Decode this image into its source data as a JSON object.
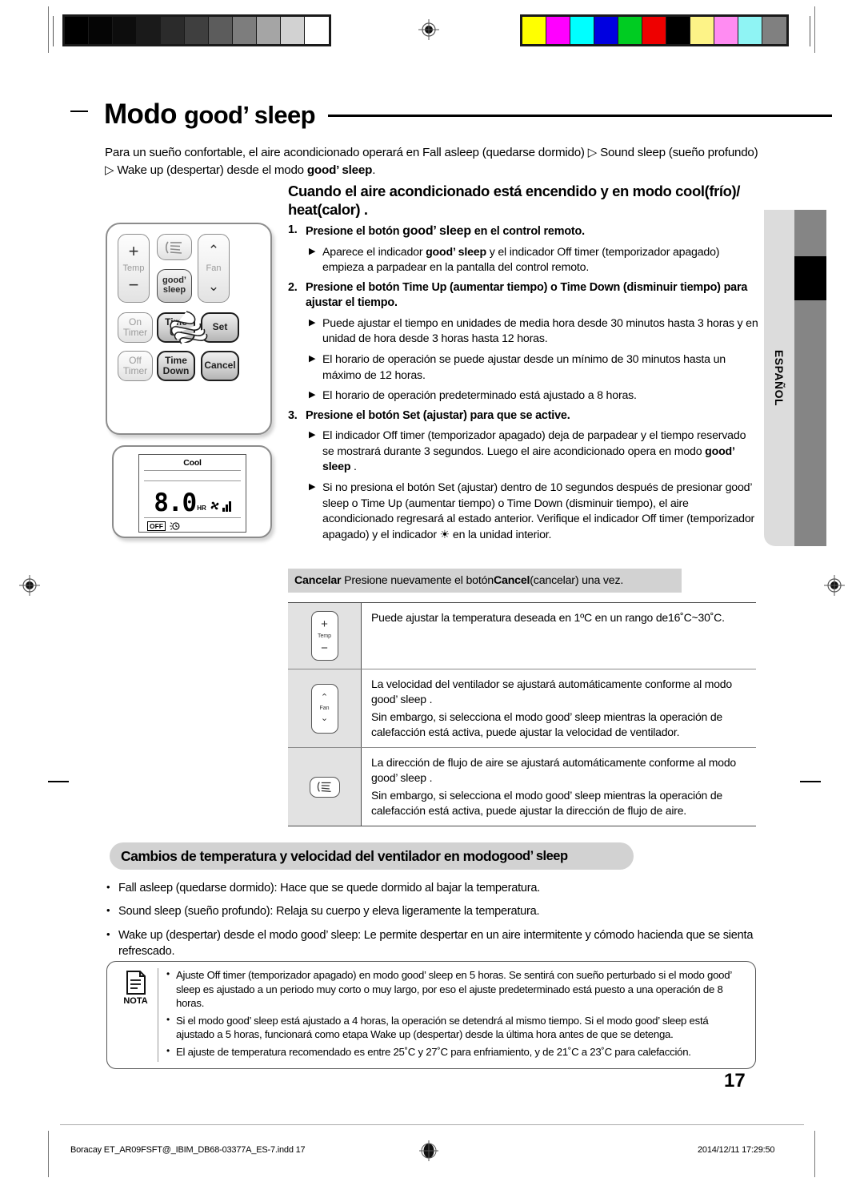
{
  "doc": {
    "title": "Modo good' sleep",
    "title_main": "Modo ",
    "title_brand": "good’ sleep",
    "page_number": "17",
    "side_tab_label": "ESPAÑOL"
  },
  "intro": {
    "line1": "Para un sueño confortable, el aire acondicionado operará en Fall asleep (quedarse dormido) ▷ Sound sleep (sueño profundo)",
    "line2_pre": "▷ Wake up (despertar) desde el modo ",
    "line2_brand": "good’ sleep",
    "line2_post": "."
  },
  "section1": {
    "heading_line1": "Cuando el aire acondicionado está encendido y en modo cool(frío)/",
    "heading_line2": "heat(calor) .",
    "steps": [
      {
        "num": "1.",
        "text_pre": "Presione el botón ",
        "brand": "good’ sleep",
        "text_post": " en el control remoto.",
        "subs": [
          {
            "pre": "Aparece el indicador ",
            "brand": "good’ sleep",
            "post": " y el indicador Off timer (temporizador apagado) empieza a parpadear en la pantalla del control remoto."
          }
        ]
      },
      {
        "num": "2.",
        "text_pre": "Presione el botón Time Up (aumentar tiempo) o Time Down (disminuir tiempo) para ajustar el tiempo.",
        "brand": "",
        "text_post": "",
        "subs": [
          {
            "pre": "Puede ajustar el tiempo en unidades de media hora desde 30 minutos hasta 3 horas y en unidad de hora desde 3 horas hasta 12 horas.",
            "brand": "",
            "post": ""
          },
          {
            "pre": "El horario de operación se puede ajustar desde un mínimo de 30 minutos hasta un máximo de 12 horas.",
            "brand": "",
            "post": ""
          },
          {
            "pre": "El horario de operación predeterminado está ajustado a 8 horas.",
            "brand": "",
            "post": ""
          }
        ]
      },
      {
        "num": "3.",
        "text_pre": "Presione el botón Set (ajustar) para que se active.",
        "brand": "",
        "text_post": "",
        "subs": [
          {
            "pre": "El indicador Off timer (temporizador apagado) deja de parpadear y el tiempo reservado se mostrará durante 3 segundos. Luego el aire acondicionado opera en modo ",
            "brand": "good’ sleep",
            "post": " ."
          },
          {
            "pre": "Si no presiona el botón Set (ajustar) dentro de 10 segundos después de presionar good’ sleep o Time Up (aumentar tiempo) o Time Down (disminuir tiempo), el aire acondicionado regresará al estado anterior.  Verifique el indicador Off timer (temporizador apagado) y el indicador ☀ en la unidad interior.",
            "brand": "",
            "post": ""
          }
        ]
      }
    ],
    "cancel_bar": {
      "label": "Cancelar",
      "text_pre": "Presione nuevamente el botón ",
      "bold": "Cancel",
      "text_post": "(cancelar) una vez."
    }
  },
  "feature_table": {
    "rows": [
      {
        "icon": "temp-key-icon",
        "icon_label": "Temp",
        "icon_top": "+",
        "icon_bottom": "−",
        "lines": [
          "Puede ajustar la temperatura deseada en 1ºC en un rango de16˚C~30˚C."
        ]
      },
      {
        "icon": "fan-key-icon",
        "icon_label": "Fan",
        "icon_top": "⌃",
        "icon_bottom": "⌄",
        "lines": [
          "La velocidad del ventilador se ajustará automáticamente conforme al modo good’ sleep .",
          "Sin embargo, si selecciona el modo good’ sleep mientras la operación de calefacción está activa, puede ajustar la velocidad de ventilador."
        ]
      },
      {
        "icon": "airflow-key-icon",
        "icon_label": "",
        "icon_top": "",
        "icon_bottom": "",
        "lines": [
          "La dirección de flujo de aire se ajustará automáticamente conforme al modo good’ sleep .",
          "Sin embargo, si selecciona el modo good’ sleep mientras la operación de calefacción está activa, puede ajustar la dirección de flujo de aire."
        ]
      }
    ]
  },
  "section2": {
    "pill_pre": "Cambios de temperatura y velocidad del ventilador en modo ",
    "pill_brand": "good’ sleep",
    "bullets": [
      "Fall asleep (quedarse dormido): Hace que se quede dormido al bajar la temperatura.",
      "Sound sleep (sueño profundo): Relaja su cuerpo y eleva ligeramente la temperatura.",
      "Wake up (despertar) desde el modo good’ sleep: Le permite despertar en un aire intermitente y cómodo hacienda que se sienta refrescado."
    ]
  },
  "nota": {
    "label": "NOTA",
    "items": [
      "Ajuste Off timer (temporizador apagado) en modo good’ sleep en 5 horas. Se sentirá con sueño perturbado si el modo good’ sleep es ajustado a un periodo muy corto o muy largo, por eso el ajuste predeterminado está puesto a una operación de 8 horas.",
      "Si el modo good’ sleep está ajustado a 4 horas, la operación se detendrá al mismo tiempo. Si el modo good’ sleep está ajustado a 5 horas, funcionará como etapa Wake up (despertar) desde la última hora antes de que se detenga.",
      "El ajuste de temperatura recomendado es entre 25˚C y 27˚C para enfriamiento, y de 21˚C a 23˚C para calefacción."
    ]
  },
  "remote": {
    "buttons": [
      {
        "name": "temp-up-down",
        "label": "Temp",
        "top": "+",
        "bottom": "−"
      },
      {
        "name": "airflow",
        "label": "",
        "top": "",
        "bottom": ""
      },
      {
        "name": "fan",
        "label": "Fan",
        "top": "⌃",
        "bottom": "⌄"
      },
      {
        "name": "good-sleep",
        "label": "good’ sleep",
        "top": "",
        "bottom": ""
      },
      {
        "name": "on-timer",
        "label": "On Timer",
        "top": "On",
        "bottom": "Timer"
      },
      {
        "name": "time-up",
        "label": "Time Up",
        "top": "Time",
        "bottom": "Up"
      },
      {
        "name": "set",
        "label": "Set",
        "top": "Set",
        "bottom": ""
      },
      {
        "name": "off-timer",
        "label": "Off Timer",
        "top": "Off",
        "bottom": "Timer"
      },
      {
        "name": "time-down",
        "label": "Time Down",
        "top": "Time",
        "bottom": "Down"
      },
      {
        "name": "cancel",
        "label": "Cancel",
        "top": "Cancel",
        "bottom": ""
      }
    ]
  },
  "lcd": {
    "mode": "Cool",
    "value": "8.0",
    "unit": "HR",
    "off_badge": "OFF",
    "fan_icon": "fan-icon",
    "sleep_icon": "good-sleep-icon"
  },
  "footer": {
    "left": "Boracay ET_AR09FSFT@_IBIM_DB68-03377A_ES-7.indd   17",
    "right": "2014/12/11   17:29:50"
  },
  "calibration": {
    "gray_patches": [
      "#000000",
      "#050505",
      "#0d0d0d",
      "#1a1a1a",
      "#2b2b2b",
      "#3f3f3f",
      "#5c5c5c",
      "#7d7d7d",
      "#a5a5a5",
      "#d2d2d2",
      "#ffffff"
    ],
    "color_patches": [
      "#ffff00",
      "#ff00ff",
      "#00ffff",
      "#0000e0",
      "#00cc22",
      "#ee0000",
      "#000000",
      "#fdf387",
      "#ff8cf2",
      "#8ff4f4",
      "#808080"
    ]
  }
}
